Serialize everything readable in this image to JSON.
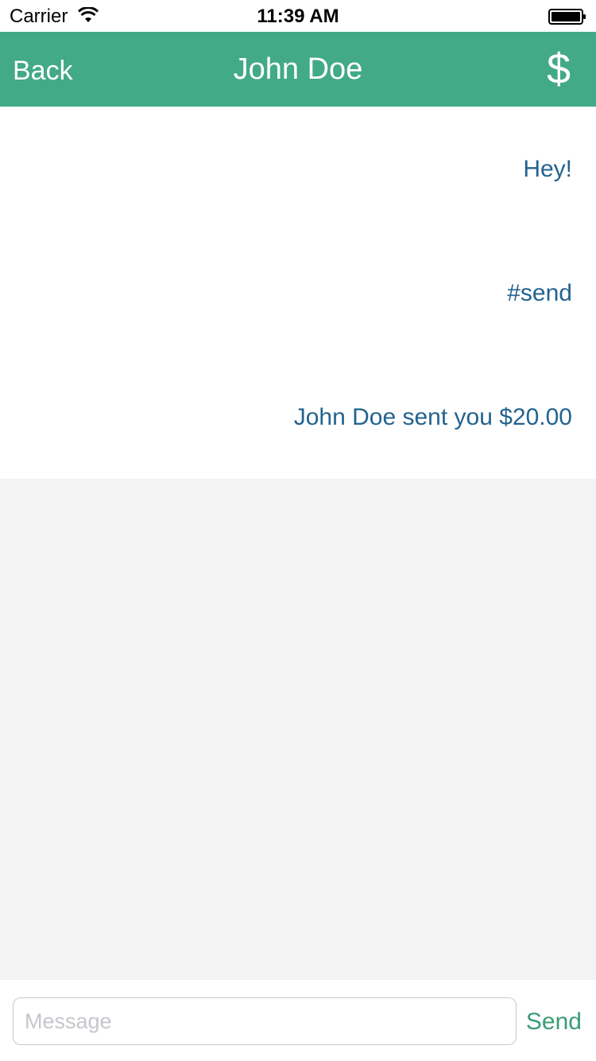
{
  "status_bar": {
    "carrier": "Carrier",
    "time": "11:39 AM",
    "wifi_icon": "wifi-icon",
    "battery_icon": "battery-icon"
  },
  "nav": {
    "back_label": "Back",
    "title": "John Doe",
    "action_icon": "$"
  },
  "messages": [
    {
      "text": "Hey!"
    },
    {
      "text": "#send"
    },
    {
      "text": "John Doe sent you $20.00"
    }
  ],
  "composer": {
    "placeholder": "Message",
    "value": "",
    "send_label": "Send"
  },
  "colors": {
    "nav_bg": "#42aa86",
    "message_text": "#23638f",
    "send_text": "#3a9c77",
    "empty_bg": "#f3f3f3"
  }
}
